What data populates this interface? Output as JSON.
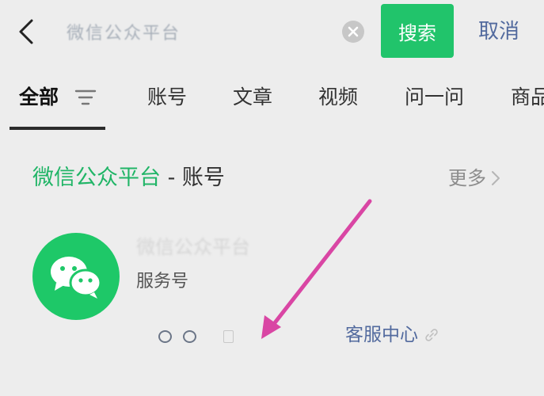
{
  "header": {
    "back_icon": "chevron-left-icon",
    "query": "微信公众平台",
    "clear_icon": "clear-circle-icon",
    "search_label": "搜索",
    "cancel_label": "取消"
  },
  "tabs": [
    {
      "label": "全部",
      "active": true
    },
    {
      "label": "账号",
      "active": false
    },
    {
      "label": "文章",
      "active": false
    },
    {
      "label": "视频",
      "active": false
    },
    {
      "label": "问一问",
      "active": false
    },
    {
      "label": "商品",
      "active": false
    }
  ],
  "filter_icon": "filter-lines-icon",
  "section": {
    "title_highlight": "微信公众平台",
    "title_separator": " - ",
    "title_suffix": "账号",
    "more_label": "更多",
    "more_icon": "chevron-right-icon"
  },
  "account": {
    "avatar_icon": "wechat-logo-icon",
    "name": "微信公众平台",
    "type": "服务号",
    "menu_icons": [
      "ring-icon",
      "ring-icon",
      "document-icon"
    ],
    "service_label": "客服中心",
    "service_icon": "link-icon"
  },
  "annotation": {
    "arrow_color": "#d946a4"
  },
  "colors": {
    "background": "#ededed",
    "brand_green": "#21c46b",
    "link_blue": "#526a9e"
  }
}
